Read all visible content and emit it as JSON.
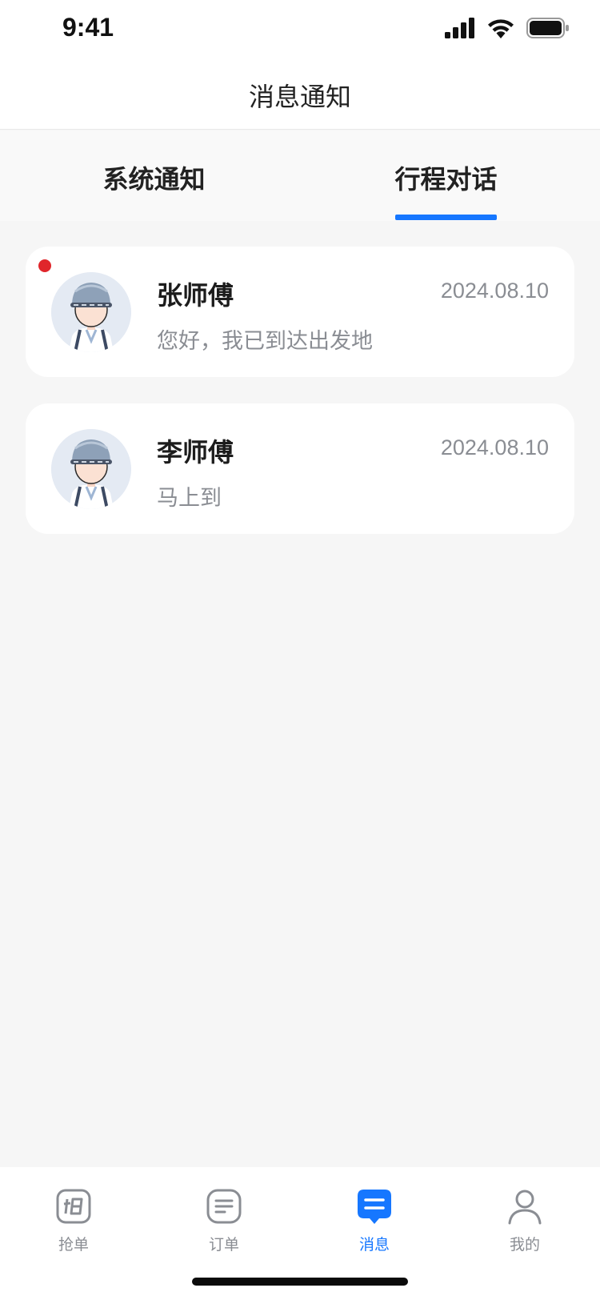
{
  "status_bar": {
    "time": "9:41"
  },
  "nav": {
    "title": "消息通知"
  },
  "tabs": [
    {
      "label": "系统通知",
      "active": false
    },
    {
      "label": "行程对话",
      "active": true
    }
  ],
  "conversations": [
    {
      "name": "张师傅",
      "date": "2024.08.10",
      "message": "您好，我已到达出发地",
      "unread": true
    },
    {
      "name": "李师傅",
      "date": "2024.08.10",
      "message": "马上到",
      "unread": false
    }
  ],
  "tab_bar": {
    "items": [
      {
        "label": "抢单",
        "icon": "grab-order-icon",
        "active": false
      },
      {
        "label": "订单",
        "icon": "order-list-icon",
        "active": false
      },
      {
        "label": "消息",
        "icon": "message-icon",
        "active": true
      },
      {
        "label": "我的",
        "icon": "profile-icon",
        "active": false
      }
    ]
  },
  "colors": {
    "accent": "#1677ff",
    "unread_dot": "#e0262b",
    "background": "#f6f6f6",
    "secondary_text": "#8a8d93"
  }
}
